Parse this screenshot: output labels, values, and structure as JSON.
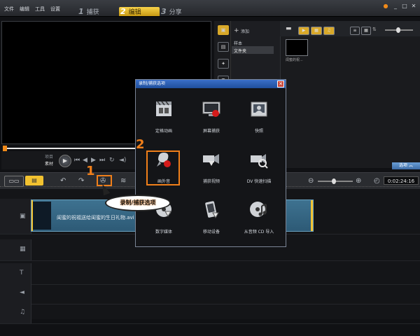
{
  "menu": {
    "file": "文件",
    "edit": "编辑",
    "tools": "工具",
    "settings": "设置"
  },
  "steps": [
    {
      "num": "1",
      "label": "捕获"
    },
    {
      "num": "2",
      "label": "编辑"
    },
    {
      "num": "3",
      "label": "分享"
    }
  ],
  "library": {
    "add_label": "添加",
    "tree": [
      "样本",
      "文件夹"
    ],
    "thumb_caption": "闺蜜的祝..."
  },
  "preview": {
    "project_label": "项目",
    "clip_label": "素材"
  },
  "timeline": {
    "clip_name": "闺蜜的祝福送给闺蜜的生日礼物.avi",
    "timecode": "0:02:24:16",
    "options_label": "选项"
  },
  "dialog": {
    "title": "录制/捕获选项",
    "close_icon": "close-icon",
    "options": [
      {
        "label": "定格动画",
        "icon": "stop-motion-icon"
      },
      {
        "label": "屏幕捕获",
        "icon": "screen-capture-icon"
      },
      {
        "label": "快照",
        "icon": "snapshot-icon"
      },
      {
        "label": "画外音",
        "icon": "voiceover-icon"
      },
      {
        "label": "捕获视频",
        "icon": "capture-video-icon"
      },
      {
        "label": "DV 快速扫描",
        "icon": "dv-scan-icon"
      },
      {
        "label": "数字媒体",
        "icon": "digital-media-icon"
      },
      {
        "label": "移动设备",
        "icon": "mobile-device-icon"
      },
      {
        "label": "从音频 CD 导入",
        "icon": "audio-cd-icon"
      }
    ]
  },
  "annotations": {
    "step1": "1",
    "step2": "2",
    "callout": "录制/捕获选项"
  },
  "colors": {
    "accent": "#f07f1a",
    "active_tab": "#f2c230",
    "dialog_title": "#2a5fb3",
    "clip": "#3a6d8a"
  }
}
